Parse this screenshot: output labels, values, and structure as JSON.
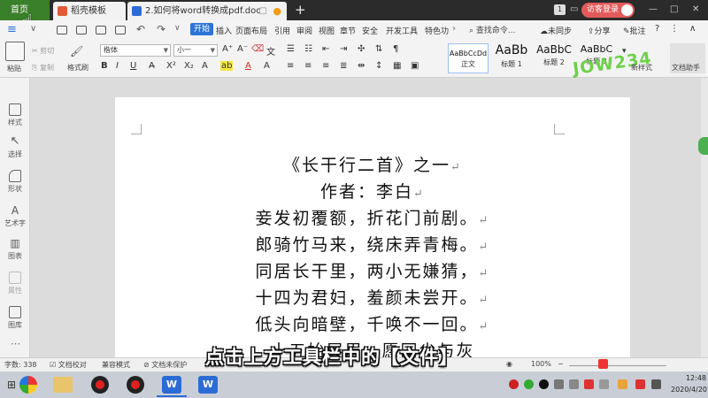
{
  "tabs": {
    "home": "首页",
    "template": "稻壳模板",
    "doc": "2.如何将word转换成pdf.doc",
    "new_tab": "+",
    "count_badge": "1",
    "visitor_login": "访客登录"
  },
  "menu": {
    "file_icon": "hamburger-menu-icon",
    "items": [
      "开始",
      "插入",
      "页面布局",
      "引用",
      "审阅",
      "视图",
      "章节",
      "安全",
      "开发工具",
      "特色功"
    ],
    "search_placeholder": "查找命令...",
    "sync": "未同步",
    "share": "分享",
    "comment": "批注"
  },
  "clipboard": {
    "paste": "粘贴",
    "cut": "剪切",
    "copy": "复制",
    "format_painter": "格式刷"
  },
  "font": {
    "family": "楷体",
    "size": "小一"
  },
  "styles": [
    {
      "sample": "AaBbCcDd",
      "name": "正文"
    },
    {
      "sample": "AaBb",
      "name": "标题 1"
    },
    {
      "sample": "AaBbC",
      "name": "标题 2"
    },
    {
      "sample": "AaBbC",
      "name": "标题 3"
    }
  ],
  "style_more": {
    "new_style": "新样式",
    "doc_assistant": "文档助手"
  },
  "logo_text": "JOW234",
  "left_tools": [
    {
      "icon": "style-icon",
      "label": "样式"
    },
    {
      "icon": "select-icon",
      "label": "选择"
    },
    {
      "icon": "shape-icon",
      "label": "形状"
    },
    {
      "icon": "word-art-icon",
      "label": "艺术字"
    },
    {
      "icon": "chart-icon",
      "label": "图表"
    },
    {
      "icon": "property-icon",
      "label": "属性"
    },
    {
      "icon": "gallery-icon",
      "label": "图库"
    }
  ],
  "poem": {
    "title": "《长干行二首》之一",
    "author": "作者：李白",
    "lines": [
      "妾发初覆额，折花门前剧。",
      "郎骑竹马来，绕床弄青梅。",
      "同居长干里，两小无嫌猜，",
      "十四为君妇，羞颜未尝开。",
      "低头向暗壁，千唤不一回。",
      "十五始展眉，愿同尘与灰"
    ],
    "para_mark": "↵"
  },
  "status": {
    "word_count": "字数: 338",
    "proofread": "文档校对",
    "compat_mode": "兼容模式",
    "unprotected": "文档未保护",
    "zoom": "100%"
  },
  "subtitle": "点击上方工具栏中的【文件】",
  "clock": {
    "time": "12:48",
    "date": "2020/4/20"
  },
  "colors": {
    "home_tab": "#3a7f2a",
    "start_tab": "#2c74d6",
    "visitor": "#e35a5a",
    "logo": "#6ed14a"
  }
}
